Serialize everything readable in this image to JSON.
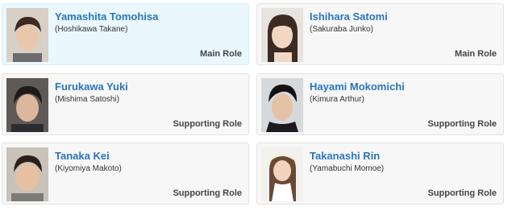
{
  "cast": [
    {
      "name": "Yamashita Tomohisa",
      "character": "(Hoshikawa Takane)",
      "role": "Main Role",
      "photo_icon": "actor-photo"
    },
    {
      "name": "Ishihara Satomi",
      "character": "(Sakuraba Junko)",
      "role": "Main Role",
      "photo_icon": "actress-photo"
    },
    {
      "name": "Furukawa Yuki",
      "character": "(Mishima Satoshi)",
      "role": "Supporting Role",
      "photo_icon": "actor-photo"
    },
    {
      "name": "Hayami Mokomichi",
      "character": "(Kimura Arthur)",
      "role": "Supporting Role",
      "photo_icon": "actor-photo"
    },
    {
      "name": "Tanaka Kei",
      "character": "(Kiyomiya Makoto)",
      "role": "Supporting Role",
      "photo_icon": "actor-photo"
    },
    {
      "name": "Takanashi Rin",
      "character": "(Yamabuchi Momoe)",
      "role": "Supporting Role",
      "photo_icon": "actress-photo"
    }
  ],
  "colors": {
    "name_link": "#2a75c0",
    "highlight_bg": "#eaf8fd",
    "card_bg": "#f7f7f7"
  }
}
